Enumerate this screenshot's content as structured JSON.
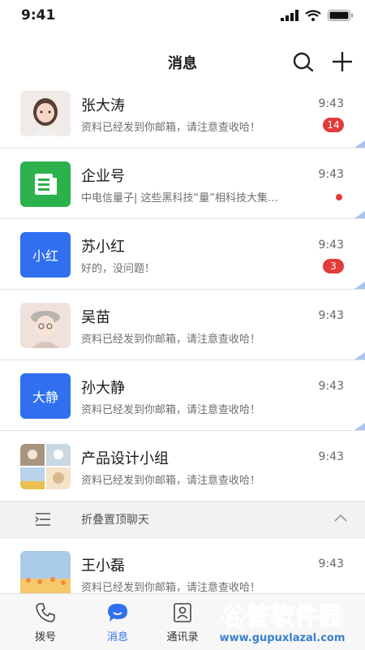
{
  "status_bar": {
    "time": "9:41"
  },
  "nav": {
    "title": "消息"
  },
  "conversations": [
    {
      "name": "张大涛",
      "preview": "资料已经发到你邮箱，请注意查收哈！",
      "time": "9:43",
      "badge": "14"
    },
    {
      "name": "企业号",
      "preview": "中电信量子| 这些黑科技“量”相科技大集…",
      "time": "9:43",
      "badge": ""
    },
    {
      "name": "苏小红",
      "preview": "好的，没问题！",
      "time": "9:43",
      "badge": "3",
      "avatar_text": "小红"
    },
    {
      "name": "吴苗",
      "preview": "资料已经发到你邮箱，请注意查收哈！",
      "time": "9:43",
      "badge": ""
    },
    {
      "name": "孙大静",
      "preview": "资料已经发到你邮箱，请注意查收哈！",
      "time": "9:43",
      "badge": "",
      "avatar_text": "大静"
    },
    {
      "name": "产品设计小组",
      "preview": "资料已经发到你邮箱，请注意查收哈！",
      "time": "9:43",
      "badge": ""
    }
  ],
  "fold": {
    "label": "折叠置顶聊天"
  },
  "conversation_extra": {
    "name": "王小磊",
    "preview": "资料已经发到你邮箱，请注意查收哈！",
    "time": "9:43"
  },
  "tabs": [
    {
      "label": "拨号"
    },
    {
      "label": "消息"
    },
    {
      "label": "通讯录"
    }
  ],
  "watermark": {
    "line1": "谷普软件园",
    "line2": "www.gupuxlazal.com"
  },
  "colors": {
    "accent": "#2f6ff0",
    "badge": "#e23b3b",
    "corner": "#a9c4ee"
  }
}
